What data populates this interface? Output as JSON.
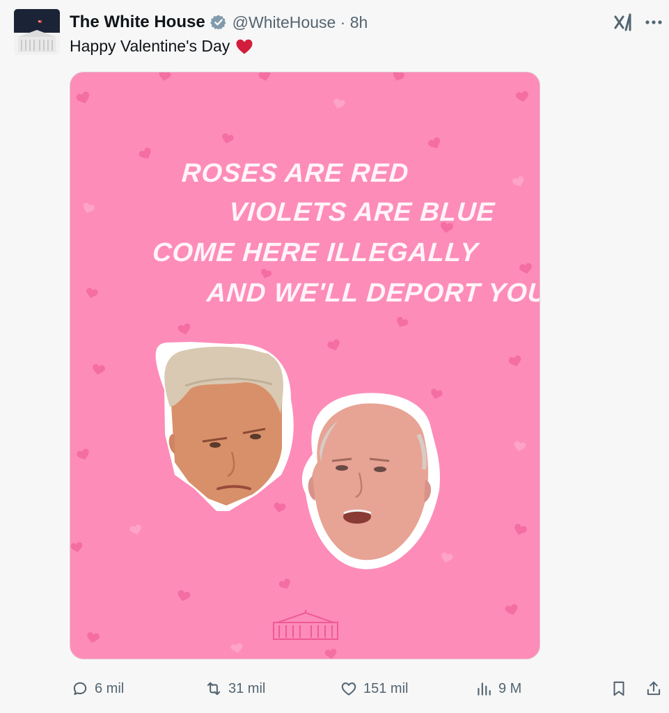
{
  "tweet": {
    "display_name": "The White House",
    "handle": "@WhiteHouse · 8h",
    "text": "Happy Valentine's Day",
    "verified_color": "#829aab",
    "heart_color": "#d21e3c"
  },
  "media": {
    "background_color": "#fd8cb9",
    "poem": [
      "ROSES ARE RED",
      "VIOLETS ARE BLUE",
      "COME HERE ILLEGALLY",
      "AND WE'LL DEPORT YOU"
    ]
  },
  "actions": {
    "replies": "6 mil",
    "reposts": "31 mil",
    "likes": "151 mil",
    "views": "9 M"
  },
  "icons": {
    "verified": "verified-badge-icon",
    "grok": "grok-icon",
    "more": "more-icon",
    "reply": "reply-icon",
    "repost": "repost-icon",
    "like": "like-icon",
    "views": "views-icon",
    "bookmark": "bookmark-icon",
    "share": "share-icon"
  }
}
